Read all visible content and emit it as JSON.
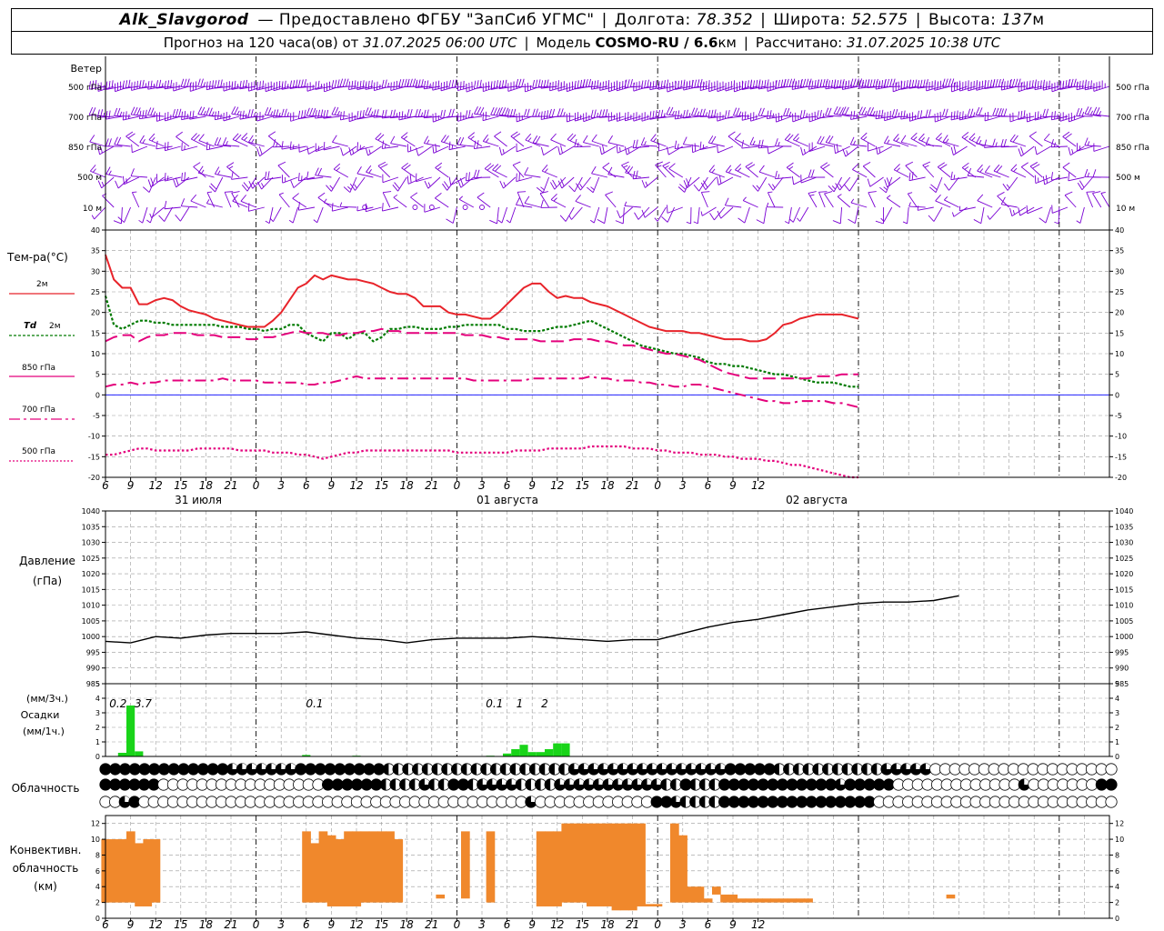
{
  "header": {
    "station": "Alk_Slavgorod",
    "provider_label": "— Предоставлено ФГБУ \"ЗапСиб УГМС\"",
    "lon_label": "Долгота:",
    "lon": "78.352",
    "lat_label": "Широта:",
    "lat": "52.575",
    "alt_label": "Высота:",
    "alt": "137",
    "alt_unit": "м",
    "forecast_label": "Прогноз на 120 часа(ов) от",
    "forecast_time": "31.07.2025 06:00 UTC",
    "model_label": "Модель",
    "model": "COSMO-RU / 6.6",
    "model_unit": "км",
    "calc_label": "Рассчитано:",
    "calc_time": "31.07.2025 10:38 UTC"
  },
  "colors": {
    "t2m": "#e8232a",
    "td": "#007a00",
    "p850": "#e4007c",
    "p700": "#e4007c",
    "p500": "#e4007c",
    "wind": "#7a00d4",
    "pressure": "#000000",
    "precip": "#19d419",
    "convective": "#f0882c",
    "zero": "#0000ff"
  },
  "chart_data": [
    {
      "type": "barbs",
      "title": "Ветер",
      "levels": [
        "500 гПа",
        "700 гПа",
        "850 гПа",
        "500 м",
        "10 м"
      ]
    },
    {
      "type": "line",
      "ylabel": "Тем-ра(°C)",
      "ylim": [
        -20,
        40
      ],
      "yticks": [
        -20,
        -15,
        -10,
        -5,
        0,
        5,
        10,
        15,
        20,
        25,
        30,
        35,
        40
      ],
      "x_hours": [
        6,
        7,
        8,
        9,
        10,
        11,
        12,
        13,
        14,
        15,
        16,
        17,
        18,
        19,
        20,
        21,
        22,
        23,
        24,
        25,
        26,
        27,
        28,
        29,
        30,
        31,
        32,
        33,
        34,
        35,
        36,
        37,
        38,
        39,
        40,
        41,
        42,
        43,
        44,
        45,
        46,
        47,
        48,
        49,
        50,
        51,
        52,
        53,
        54,
        55,
        56,
        57,
        58,
        59,
        60,
        61,
        62,
        63,
        64,
        65,
        66,
        67,
        68,
        69,
        70,
        71,
        72,
        73,
        74,
        75,
        76,
        77,
        78,
        79,
        80,
        81,
        82,
        83,
        84,
        85,
        86,
        87,
        88,
        89,
        90,
        91,
        92,
        93,
        94,
        95,
        96,
        97,
        98,
        99,
        100,
        101,
        102,
        103,
        104,
        105,
        106,
        107,
        108,
        109,
        110,
        111,
        112,
        113,
        114,
        115,
        116,
        117,
        118,
        119,
        120,
        121,
        122,
        123,
        124,
        125,
        126
      ],
      "series": [
        {
          "name": "2м",
          "style": "solid",
          "values": [
            34,
            28,
            26,
            26,
            22,
            22,
            23,
            23.5,
            23,
            21.5,
            20.5,
            20,
            19.5,
            18.5,
            18,
            17.5,
            17,
            16.5,
            16.5,
            16.5,
            18,
            20,
            23,
            26,
            27,
            29,
            28,
            29,
            28.5,
            28,
            28,
            27.5,
            27,
            26,
            25,
            24.5,
            24.5,
            23.5,
            21.5,
            21.5,
            21.5,
            20,
            19.5,
            19.5,
            19,
            18.5,
            18.5,
            20,
            22,
            24,
            26,
            27,
            27,
            25,
            23.5,
            24,
            23.5,
            23.5,
            22.5,
            22,
            21.5,
            20.5,
            19.5,
            18.5,
            17.5,
            16.5,
            16,
            15.5,
            15.5,
            15.5,
            15,
            15,
            14.5,
            14,
            13.5,
            13.5,
            13.5,
            13,
            13,
            13.5,
            15,
            17,
            17.5,
            18.5,
            19,
            19.5,
            19.5,
            19.5,
            19.5,
            19,
            18.5
          ]
        },
        {
          "name": "Td 2м",
          "style": "dotted",
          "values": [
            24,
            17,
            16,
            17,
            18,
            18,
            17.5,
            17.5,
            17,
            17,
            17,
            17,
            17,
            17,
            16.5,
            16.5,
            16.5,
            16,
            16,
            15.5,
            16,
            16,
            17,
            17,
            15,
            14,
            13,
            15,
            15,
            13.5,
            15,
            15,
            13,
            14,
            16,
            16,
            16.5,
            16.5,
            16,
            16,
            16,
            16.5,
            16.5,
            17,
            17,
            17,
            17,
            17,
            16,
            16,
            15.5,
            15.5,
            15.5,
            16,
            16.5,
            16.5,
            17,
            17.5,
            18,
            17,
            16,
            15,
            14,
            13,
            12,
            11.5,
            11,
            10.5,
            10,
            10,
            9.5,
            9,
            8,
            7.5,
            7.5,
            7,
            7,
            6.5,
            6,
            5.5,
            5,
            5,
            4.5,
            4,
            3.5,
            3,
            3,
            3,
            2.5,
            2,
            2
          ]
        },
        {
          "name": "850 гПа",
          "style": "dash",
          "values": [
            13,
            14,
            14.5,
            14.5,
            13,
            14,
            14.5,
            14.5,
            15,
            15,
            15,
            14.5,
            14.5,
            14.5,
            14,
            14,
            14,
            13.5,
            13.5,
            14,
            14,
            14.5,
            15,
            15.5,
            15,
            15,
            15,
            14.5,
            14.5,
            15,
            15,
            15.5,
            15.5,
            16,
            15.5,
            15.5,
            15,
            15,
            15,
            15,
            15,
            15,
            15,
            14.5,
            14.5,
            14.5,
            14,
            14,
            13.5,
            13.5,
            13.5,
            13.5,
            13,
            13,
            13,
            13,
            13.5,
            13.5,
            13.5,
            13,
            13,
            12.5,
            12,
            12,
            11.5,
            11,
            10.5,
            10,
            10,
            9.5,
            9,
            8.5,
            7.5,
            6.5,
            5.5,
            5,
            4.5,
            4,
            4,
            4,
            4,
            4,
            4,
            4,
            4,
            4.5,
            4.5,
            4.5,
            5,
            5,
            5
          ]
        },
        {
          "name": "700 гПа",
          "style": "dashdot",
          "values": [
            2,
            2.5,
            2.5,
            3,
            2.5,
            3,
            3,
            3.5,
            3.5,
            3.5,
            3.5,
            3.5,
            3.5,
            3.5,
            4,
            3.5,
            3.5,
            3.5,
            3.5,
            3,
            3,
            3,
            3,
            3,
            2.5,
            2.5,
            3,
            3,
            3.5,
            4,
            4.5,
            4,
            4,
            4,
            4,
            4,
            4,
            4,
            4,
            4,
            4,
            4,
            4,
            4,
            3.5,
            3.5,
            3.5,
            3.5,
            3.5,
            3.5,
            3.5,
            4,
            4,
            4,
            4,
            4,
            4,
            4,
            4.5,
            4,
            4,
            3.5,
            3.5,
            3.5,
            3,
            3,
            2.5,
            2.5,
            2,
            2,
            2.5,
            2.5,
            2,
            1.5,
            1,
            0.5,
            0,
            -0.5,
            -1,
            -1.5,
            -1.5,
            -2,
            -2,
            -1.5,
            -1.5,
            -1.5,
            -1.5,
            -2,
            -2,
            -2.5,
            -3
          ]
        },
        {
          "name": "500 гПа",
          "style": "dot",
          "values": [
            -14.5,
            -14.5,
            -14,
            -13.5,
            -13,
            -13,
            -13.5,
            -13.5,
            -13.5,
            -13.5,
            -13.5,
            -13,
            -13,
            -13,
            -13,
            -13,
            -13.5,
            -13.5,
            -13.5,
            -13.5,
            -14,
            -14,
            -14,
            -14.5,
            -14.5,
            -15,
            -15.5,
            -15,
            -14.5,
            -14,
            -14,
            -13.5,
            -13.5,
            -13.5,
            -13.5,
            -13.5,
            -13.5,
            -13.5,
            -13.5,
            -13.5,
            -13.5,
            -13.5,
            -14,
            -14,
            -14,
            -14,
            -14,
            -14,
            -14,
            -13.5,
            -13.5,
            -13.5,
            -13.5,
            -13,
            -13,
            -13,
            -13,
            -13,
            -12.5,
            -12.5,
            -12.5,
            -12.5,
            -12.5,
            -13,
            -13,
            -13,
            -13.5,
            -13.5,
            -14,
            -14,
            -14,
            -14.5,
            -14.5,
            -14.5,
            -15,
            -15,
            -15.5,
            -15.5,
            -15.5,
            -16,
            -16,
            -16.5,
            -17,
            -17,
            -17.5,
            -18,
            -18.5,
            -19,
            -19.5,
            -20,
            -20
          ]
        }
      ]
    },
    {
      "type": "line",
      "ylabel": "Давление (гПа)",
      "ylim": [
        985,
        1040
      ],
      "yticks": [
        985,
        990,
        995,
        1000,
        1005,
        1010,
        1015,
        1020,
        1025,
        1030,
        1035,
        1040
      ],
      "x_hours_step": 3,
      "series": [
        {
          "name": "Давление",
          "values": [
            998.5,
            998,
            1000,
            999.5,
            1000.5,
            1001,
            1001,
            1001,
            1001.5,
            1000.5,
            999.5,
            999,
            998,
            999,
            999.5,
            999.5,
            999.5,
            1000,
            999.5,
            999,
            998.5,
            999,
            999,
            1001,
            1003,
            1004.5,
            1005.5,
            1007,
            1008.5,
            1009.5,
            1010.5,
            1011,
            1011,
            1011.5,
            1013
          ]
        }
      ]
    },
    {
      "type": "bar",
      "ylabel": "Осадки (мм/1ч.)",
      "unit_label": "(мм/3ч.)",
      "ylim": [
        0,
        5
      ],
      "yticks": [
        0,
        1,
        2,
        3,
        4,
        5
      ],
      "hourly_values": {
        "8": 0.25,
        "9": 3.5,
        "10": 0.35,
        "30": 0.1,
        "36": 0.05,
        "52": 0.05,
        "54": 0.2,
        "55": 0.5,
        "56": 0.8,
        "57": 0.3,
        "58": 0.3,
        "59": 0.5,
        "60": 0.9,
        "61": 0.9
      },
      "labels_3h": [
        {
          "hour": 7.5,
          "text": "0.2"
        },
        {
          "hour": 10.5,
          "text": "3.7"
        },
        {
          "hour": 31,
          "text": "0.1"
        },
        {
          "hour": 52.5,
          "text": "0.1"
        },
        {
          "hour": 55.5,
          "text": "1"
        },
        {
          "hour": 58.5,
          "text": "2"
        }
      ]
    },
    {
      "type": "cloud_circles",
      "ylabel": "Облачность",
      "rows": [
        "fffffffffffffqqqqqqqfffffffffhhhhhhhhhhhhhhhhhhhqqqqqqqqqqqqqqqqfffffhhhhhhhhhhhqqqqqeeeeeeeeeeeeeeeeeee",
        "ffffffeeeeeeeeeeeeeeeeeffffffhhhhqhhffhqqqqhhhhqqqqqqqqqqqhhfhhhffffffffffffqfffffeeeeeeeeeeeeeqeeeeeeeff",
        "eeqfeeeeeeeeeeeeeeeeeeeeeeeeeeeeeeeeeeeeeeeeqeeeeeeeeeeeeffqhhhhffffffffffffffffeeeeeeeeeeeeeeeeeeeeeeeee"
      ]
    },
    {
      "type": "range_bar",
      "ylabel": "Конвективн. облачность (км)",
      "ylim": [
        0,
        13
      ],
      "yticks": [
        0,
        2,
        4,
        6,
        8,
        10,
        12
      ],
      "bars": [
        [
          6,
          9,
          2,
          10
        ],
        [
          7,
          9,
          2,
          10
        ],
        [
          8,
          9,
          2,
          10
        ],
        [
          9,
          9,
          2,
          11
        ],
        [
          10,
          9,
          1.5,
          9.5
        ],
        [
          11,
          9,
          1.5,
          10
        ],
        [
          12,
          9,
          2,
          10
        ],
        [
          30,
          30,
          2,
          11
        ],
        [
          31,
          30,
          2,
          9.5
        ],
        [
          32,
          30,
          2,
          11
        ],
        [
          33,
          30,
          1.5,
          10.5
        ],
        [
          34,
          30,
          1.5,
          10
        ],
        [
          35,
          30,
          1.5,
          11
        ],
        [
          36,
          30,
          1.5,
          11
        ],
        [
          37,
          30,
          2,
          11
        ],
        [
          38,
          30,
          2,
          11
        ],
        [
          39,
          30,
          2,
          11
        ],
        [
          40,
          30,
          2,
          11
        ],
        [
          41,
          30,
          2,
          10
        ],
        [
          46,
          46,
          2.5,
          3
        ],
        [
          49,
          49,
          2.5,
          11
        ],
        [
          52,
          52,
          2,
          11
        ],
        [
          58,
          58,
          1.5,
          11
        ],
        [
          59,
          58,
          1.5,
          11
        ],
        [
          60,
          58,
          1.5,
          11
        ],
        [
          61,
          58,
          2,
          12
        ],
        [
          62,
          58,
          2,
          12
        ],
        [
          63,
          58,
          2,
          12
        ],
        [
          64,
          58,
          1.5,
          12
        ],
        [
          65,
          58,
          1.5,
          12
        ],
        [
          66,
          58,
          1.5,
          12
        ],
        [
          67,
          58,
          1,
          12
        ],
        [
          68,
          58,
          1,
          12
        ],
        [
          69,
          58,
          1,
          12
        ],
        [
          70,
          58,
          1.5,
          12
        ],
        [
          71,
          58,
          1.5,
          1.8
        ],
        [
          72,
          58,
          1.5,
          1.8
        ],
        [
          73,
          58,
          2,
          1.8
        ],
        [
          74,
          58,
          2,
          12
        ],
        [
          75,
          58,
          2,
          10.5
        ],
        [
          76,
          58,
          2,
          4
        ],
        [
          77,
          58,
          2,
          4
        ],
        [
          78,
          58,
          2,
          2.5
        ],
        [
          79,
          58,
          3,
          4
        ],
        [
          80,
          58,
          2,
          3
        ],
        [
          81,
          58,
          2,
          3
        ],
        [
          82,
          58,
          2,
          2.5
        ],
        [
          83,
          58,
          2,
          2.5
        ],
        [
          84,
          58,
          2,
          2.5
        ],
        [
          85,
          58,
          2,
          2.5
        ],
        [
          86,
          58,
          2,
          2.5
        ],
        [
          87,
          58,
          2,
          2.5
        ],
        [
          88,
          58,
          2,
          2.5
        ],
        [
          89,
          58,
          2,
          2.5
        ],
        [
          90,
          58,
          2,
          2.5
        ],
        [
          107,
          107,
          2.5,
          3
        ]
      ]
    }
  ],
  "x_axis": {
    "hour_labels": [
      "6",
      "9",
      "12",
      "15",
      "18",
      "21",
      "0",
      "3",
      "6",
      "9",
      "12",
      "15",
      "18",
      "21",
      "0",
      "3",
      "6",
      "9",
      "12",
      "15",
      "18",
      "21",
      "0",
      "3",
      "6",
      "9",
      "12"
    ],
    "date_labels": [
      "31 июля",
      "01 августа",
      "02 августа"
    ]
  },
  "legend": {
    "temp_title": "Тем-ра(°C)",
    "t2m": "2м",
    "td_name": "Td",
    "td_level": "2м",
    "p850": "850 гПа",
    "p700": "700 гПа",
    "p500": "500 гПа",
    "wind_title": "Ветер",
    "wind_levels": [
      "500 гПа",
      "700 гПа",
      "850 гПа",
      "500 м",
      "10 м"
    ],
    "pressure_title": "Давление",
    "pressure_unit": "(гПа)",
    "precip_unit3": "(мм/3ч.)",
    "precip_title": "Осадки",
    "precip_unit1": "(мм/1ч.)",
    "cloud_title": "Облачность",
    "conv_title1": "Конвективн.",
    "conv_title2": "облачность",
    "conv_unit": "(км)"
  }
}
